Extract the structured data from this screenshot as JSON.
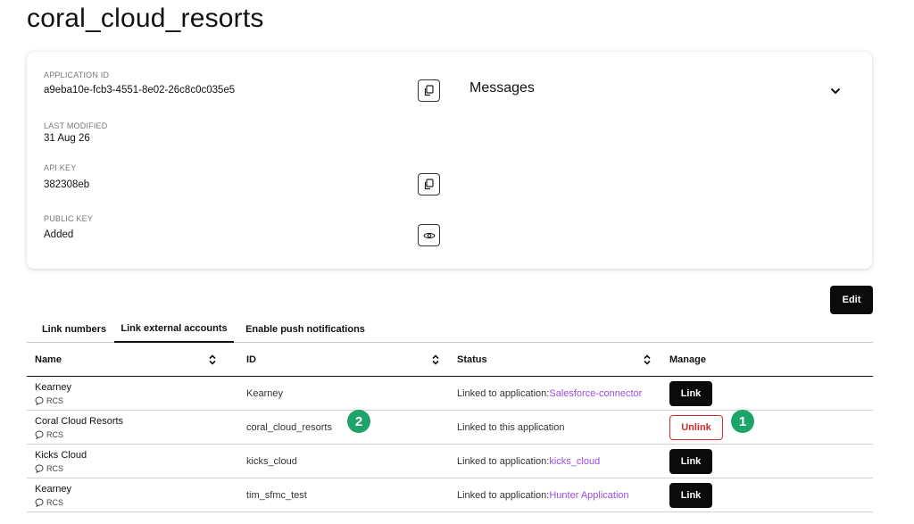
{
  "page": {
    "title": "coral_cloud_resorts"
  },
  "details": {
    "application_id": {
      "label": "APPLICATION ID",
      "value": "a9eba10e-fcb3-4551-8e02-26c8c0c035e5",
      "action_icon": "copy-icon"
    },
    "last_modified": {
      "label": "LAST MODIFIED",
      "value": "31 Aug 26"
    },
    "api_key": {
      "label": "API KEY",
      "value": "382308eb",
      "action_icon": "copy-icon"
    },
    "public_key": {
      "label": "PUBLIC KEY",
      "value": "Added",
      "action_icon": "eye-icon"
    },
    "messages_title": "Messages",
    "messages_toggle_icon": "chevron-down-icon"
  },
  "toolbar": {
    "edit_label": "Edit"
  },
  "tabs": [
    {
      "label": "Link numbers",
      "active": false
    },
    {
      "label": "Link external accounts",
      "active": true
    },
    {
      "label": "Enable push notifications",
      "active": false
    }
  ],
  "table": {
    "columns": [
      {
        "label": "Name",
        "sortable": true
      },
      {
        "label": "ID",
        "sortable": true
      },
      {
        "label": "Status",
        "sortable": true
      },
      {
        "label": "Manage",
        "sortable": false
      }
    ],
    "rows": [
      {
        "name": "Kearney",
        "channel": "RCS",
        "id": "Kearney",
        "status_prefix": "Linked to application: ",
        "status_link": "Salesforce-connector",
        "action": "Link"
      },
      {
        "name": "Coral Cloud Resorts",
        "channel": "RCS",
        "id": "coral_cloud_resorts",
        "status_prefix": "Linked to this application",
        "status_link": "",
        "action": "Unlink"
      },
      {
        "name": "Kicks Cloud",
        "channel": "RCS",
        "id": "kicks_cloud",
        "status_prefix": "Linked to application: ",
        "status_link": "kicks_cloud",
        "action": "Link"
      },
      {
        "name": "Kearney",
        "channel": "RCS",
        "id": "tim_sfmc_test",
        "status_prefix": "Linked to application: ",
        "status_link": "Hunter Application",
        "action": "Link"
      }
    ]
  },
  "annotations": {
    "badge_1": "1",
    "badge_2": "2",
    "badge_color": "#1ea36a"
  },
  "colors": {
    "link_purple": "#9b4dde",
    "unlink_red": "#d02b2b",
    "primary_button": "#0b0b0b"
  }
}
